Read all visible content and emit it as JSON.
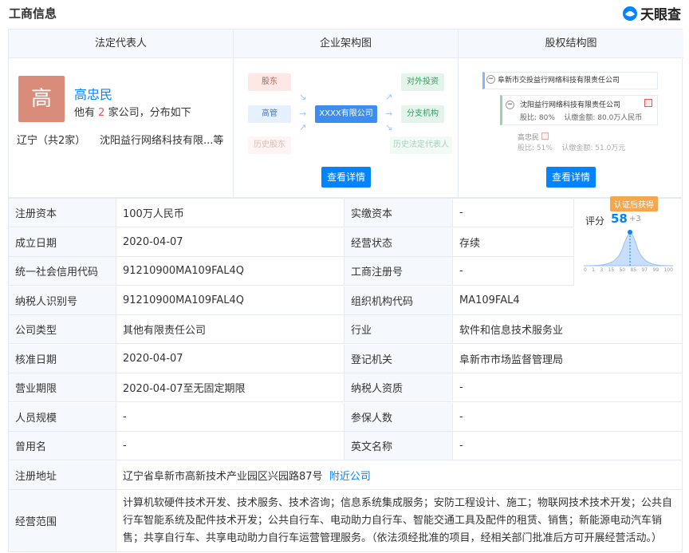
{
  "header": {
    "title": "工商信息",
    "logo_text": "天眼查"
  },
  "panel": {
    "legal_rep": {
      "heading": "法定代表人",
      "avatar_char": "高",
      "name": "高忠民",
      "sub_prefix": "他有",
      "sub_count": "2",
      "sub_suffix": "家公司，分布如下",
      "region": "辽宁（共2家）",
      "company": "沈阳益行网络科技有限...等"
    },
    "org": {
      "heading": "企业架构图",
      "shareholder": "股东",
      "manager": "高管",
      "history_sh": "历史股东",
      "center": "XXXX有限公司",
      "invest": "对外投资",
      "branch": "分支机构",
      "history_rep": "历史法定代表人",
      "button": "查看详情"
    },
    "equity": {
      "heading": "股权结构图",
      "top": "阜新市交投益行网络科技有限责任公司",
      "child": "沈阳益行网络科技有限责任公司",
      "child_ratio": "股比: 80%",
      "child_amount": "认缴金额: 80.0万人民币",
      "person": "高忠民",
      "person_ratio": "股比: 51%",
      "person_amount": "认缴金额: 51.0万元",
      "button": "查看详情"
    }
  },
  "score": {
    "badge": "认证后获得",
    "label": "评分",
    "value": "58",
    "plus": "+3",
    "ticks": [
      "0",
      "1",
      "3",
      "15",
      "50",
      "85",
      "97",
      "99",
      "100"
    ]
  },
  "rows": [
    {
      "l1": "注册资本",
      "v1": "100万人民币",
      "l2": "实缴资本",
      "v2": "-"
    },
    {
      "l1": "成立日期",
      "v1": "2020-04-07",
      "l2": "经营状态",
      "v2": "存续"
    },
    {
      "l1": "统一社会信用代码",
      "v1": "91210900MA109FAL4Q",
      "l2": "工商注册号",
      "v2": "-"
    },
    {
      "l1": "纳税人识别号",
      "v1": "91210900MA109FAL4Q",
      "l2": "组织机构代码",
      "v2": "MA109FAL4"
    },
    {
      "l1": "公司类型",
      "v1": "其他有限责任公司",
      "l2": "行业",
      "v2": "软件和信息技术服务业"
    },
    {
      "l1": "核准日期",
      "v1": "2020-04-07",
      "l2": "登记机关",
      "v2": "阜新市市场监督管理局"
    },
    {
      "l1": "营业期限",
      "v1": "2020-04-07至无固定期限",
      "l2": "纳税人资质",
      "v2": "-"
    },
    {
      "l1": "人员规模",
      "v1": "-",
      "l2": "参保人数",
      "v2": "-"
    },
    {
      "l1": "曾用名",
      "v1": "-",
      "l2": "英文名称",
      "v2": "-"
    }
  ],
  "address": {
    "label": "注册地址",
    "value": "辽宁省阜新市高新技术产业园区兴园路87号",
    "link": "附近公司"
  },
  "scope": {
    "label": "经营范围",
    "value": "计算机软硬件技术开发、技术服务、技术咨询；信息系统集成服务；安防工程设计、施工；物联网技术技术开发；公共自行车智能系统及配件技术开发；公共自行车、电动助力自行车、智能交通工具及配件的租赁、销售；新能源电动汽车销售；共享自行车、共享电动助力自行车运营管理服务。（依法须经批准的项目，经相关部门批准后方可开展经营活动。）"
  }
}
